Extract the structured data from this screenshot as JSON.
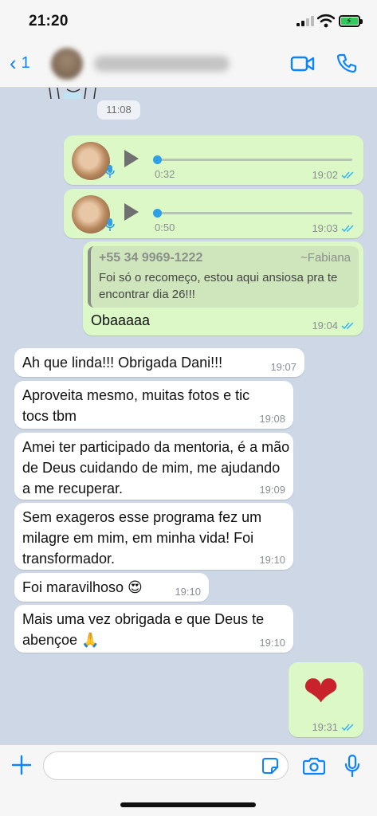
{
  "status_bar": {
    "time": "21:20"
  },
  "header": {
    "back_count": "1",
    "contact_name": "•••••• ••••"
  },
  "colors": {
    "accent": "#0a84ff",
    "outgoing_bubble": "#dcf8c6",
    "incoming_bubble": "#ffffff",
    "chat_bg": "#cdd7e6",
    "read_ticks": "#34b7f1"
  },
  "chat": {
    "date_stamp": "11:08",
    "voice_messages": [
      {
        "duration": "0:32",
        "time": "19:02"
      },
      {
        "duration": "0:50",
        "time": "19:03"
      }
    ],
    "reply": {
      "quoted_sender": "+55 34 9969-1222",
      "quoted_pushname": "~Fabiana",
      "quoted_text": "Foi só o recomeço, estou aqui ansiosa pra te encontrar dia 26!!!",
      "text": "Obaaaaa",
      "time": "19:04"
    },
    "incoming": [
      {
        "text": "Ah que linda!!! Obrigada Dani!!!",
        "time": "19:07"
      },
      {
        "text": "Aproveita mesmo, muitas  fotos e tic tocs tbm",
        "time": "19:08"
      },
      {
        "text": "Amei ter participado da mentoria, é a mão de Deus cuidando de mim, me ajudando a me recuperar.",
        "time": "19:09"
      },
      {
        "text": "Sem exageros esse programa fez um milagre em mim, em minha vida! Foi transformador.",
        "time": "19:10"
      },
      {
        "text": "Foi maravilhoso 😍",
        "time": "19:10"
      },
      {
        "text": "Mais uma vez obrigada e que Deus te abençoe 🙏",
        "time": "19:10"
      }
    ],
    "heart": {
      "emoji": "❤",
      "time": "19:31"
    }
  },
  "composer": {
    "placeholder": ""
  }
}
